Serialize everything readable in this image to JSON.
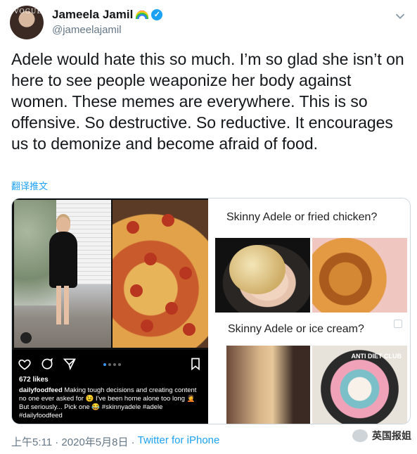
{
  "user": {
    "display_name": "Jameela Jamil",
    "handle": "@jameelajamil",
    "avatar_text": "VOGUE"
  },
  "tweet": {
    "text": "Adele would hate this so much. I’m so glad she isn’t on here to see people weaponize her body against women. These memes are everywhere. This is so offensive. So destructive. So reductive. It encourages us to demonize and become afraid of food.",
    "translate_label": "翻译推文"
  },
  "media": {
    "instagram": {
      "likes": "672 likes",
      "username": "dailyfoodfeed",
      "caption": "Making tough decisions and creating content no one ever asked for 😉 I've been home alone too long 🤦 But seriously... Pick one 😂 #skinnyadele #adele #dailyfoodfeed",
      "dots": 4,
      "active_dot": 1
    },
    "compare": {
      "q1": "Skinny Adele or fried chicken?",
      "q2": "Skinny Adele or ice cream?",
      "anti_diet_label": "ANTI DIET CLUB"
    }
  },
  "meta": {
    "time": "上午5:11 · 2020年5月8日 ·",
    "source": "Twitter for iPhone"
  },
  "watermark": {
    "text": "英国报姐"
  },
  "colors": {
    "accent": "#1da1f2",
    "text_primary": "#14171a",
    "text_secondary": "#657786"
  }
}
